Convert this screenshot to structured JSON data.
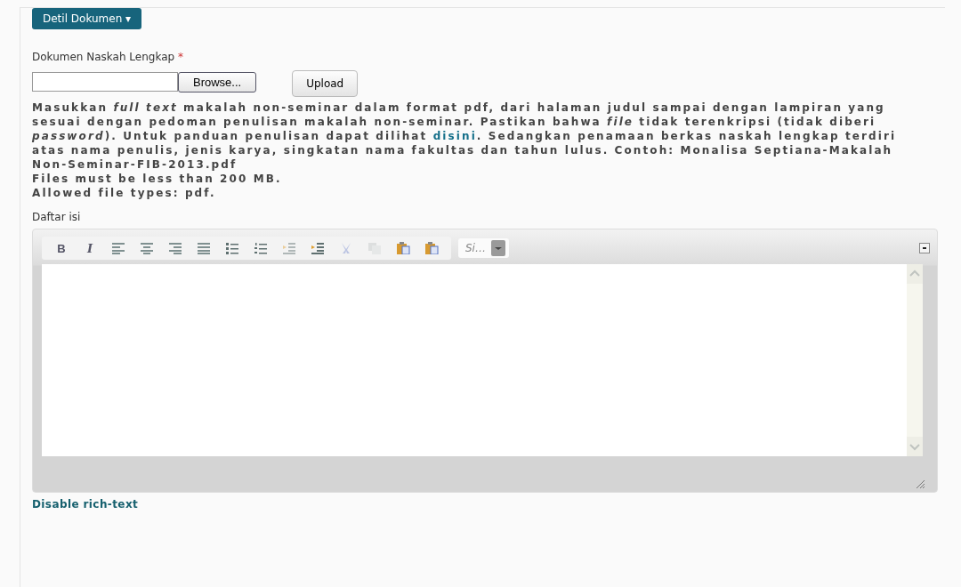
{
  "section_button": {
    "label": "Detil Dokumen",
    "caret": "▾"
  },
  "upload": {
    "label": "Dokumen Naskah Lengkap",
    "required_mark": "*",
    "browse": "Browse...",
    "upload": "Upload"
  },
  "description": {
    "before_link": "Masukkan *full text* makalah non-seminar dalam format pdf, dari halaman judul sampai dengan lampiran yang sesuai dengan pedoman penulisan makalah non-seminar. Pastikan bahwa *file* tidak terenkripsi (tidak diberi *password*). Untuk panduan penulisan dapat dilihat",
    "link": "disini",
    "after_link": ". Sedangkan penamaan berkas naskah lengkap terdiri atas nama penulis, jenis karya, singkatan nama fakultas dan tahun lulus. Contoh: Monalisa Septiana-Makalah Non-Seminar-FIB-2013.pdf"
  },
  "limits": [
    "Files must be less than 200 MB.",
    "Allowed file types: pdf."
  ],
  "editor": {
    "label": "Daftar isi",
    "toolbar": [
      {
        "kind": "bold",
        "label": "B",
        "disabled": false
      },
      {
        "kind": "italic",
        "label": "I",
        "disabled": false
      },
      {
        "kind": "align-left",
        "disabled": false
      },
      {
        "kind": "align-center",
        "disabled": false
      },
      {
        "kind": "align-right",
        "disabled": false
      },
      {
        "kind": "justify",
        "disabled": false
      },
      {
        "kind": "bullets",
        "disabled": false
      },
      {
        "kind": "numbers",
        "disabled": false
      },
      {
        "kind": "outdent",
        "disabled": true
      },
      {
        "kind": "indent",
        "disabled": false
      },
      {
        "kind": "cut",
        "disabled": true
      },
      {
        "kind": "copy",
        "disabled": true
      },
      {
        "kind": "paste",
        "disabled": false
      },
      {
        "kind": "paste-word",
        "disabled": false
      }
    ],
    "font_select": "Si…"
  },
  "toggle_link": "Disable rich-text"
}
